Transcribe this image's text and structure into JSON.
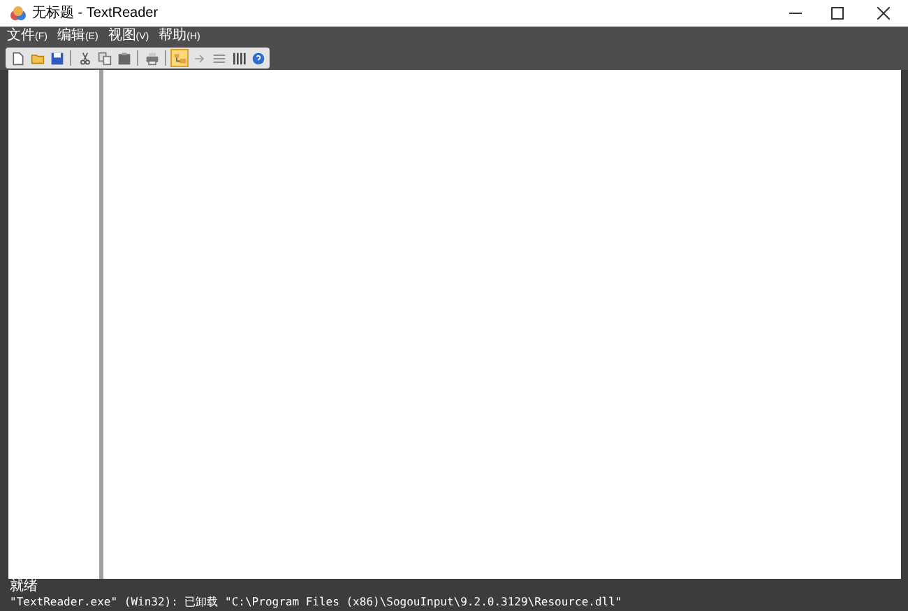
{
  "window": {
    "title": "无标题 - TextReader"
  },
  "menu": [
    {
      "label": "文件",
      "key": "(F)"
    },
    {
      "label": "编辑",
      "key": "(E)"
    },
    {
      "label": "视图",
      "key": "(V)"
    },
    {
      "label": "帮助",
      "key": "(H)"
    }
  ],
  "toolbar": [
    {
      "kind": "new",
      "selected": false
    },
    {
      "kind": "open",
      "selected": false
    },
    {
      "kind": "save",
      "selected": false
    },
    {
      "kind": "sep"
    },
    {
      "kind": "cut",
      "selected": false
    },
    {
      "kind": "copy",
      "selected": false
    },
    {
      "kind": "paste",
      "selected": false
    },
    {
      "kind": "sep"
    },
    {
      "kind": "print",
      "selected": false
    },
    {
      "kind": "sep"
    },
    {
      "kind": "tree",
      "selected": true
    },
    {
      "kind": "arrow",
      "selected": false
    },
    {
      "kind": "list",
      "selected": false
    },
    {
      "kind": "columns",
      "selected": false
    },
    {
      "kind": "help",
      "selected": false
    }
  ],
  "status_bar": {
    "text": "就绪"
  },
  "output_line": "\"TextReader.exe\" (Win32): 已卸载 \"C:\\Program Files (x86)\\SogouInput\\9.2.0.3129\\Resource.dll\""
}
